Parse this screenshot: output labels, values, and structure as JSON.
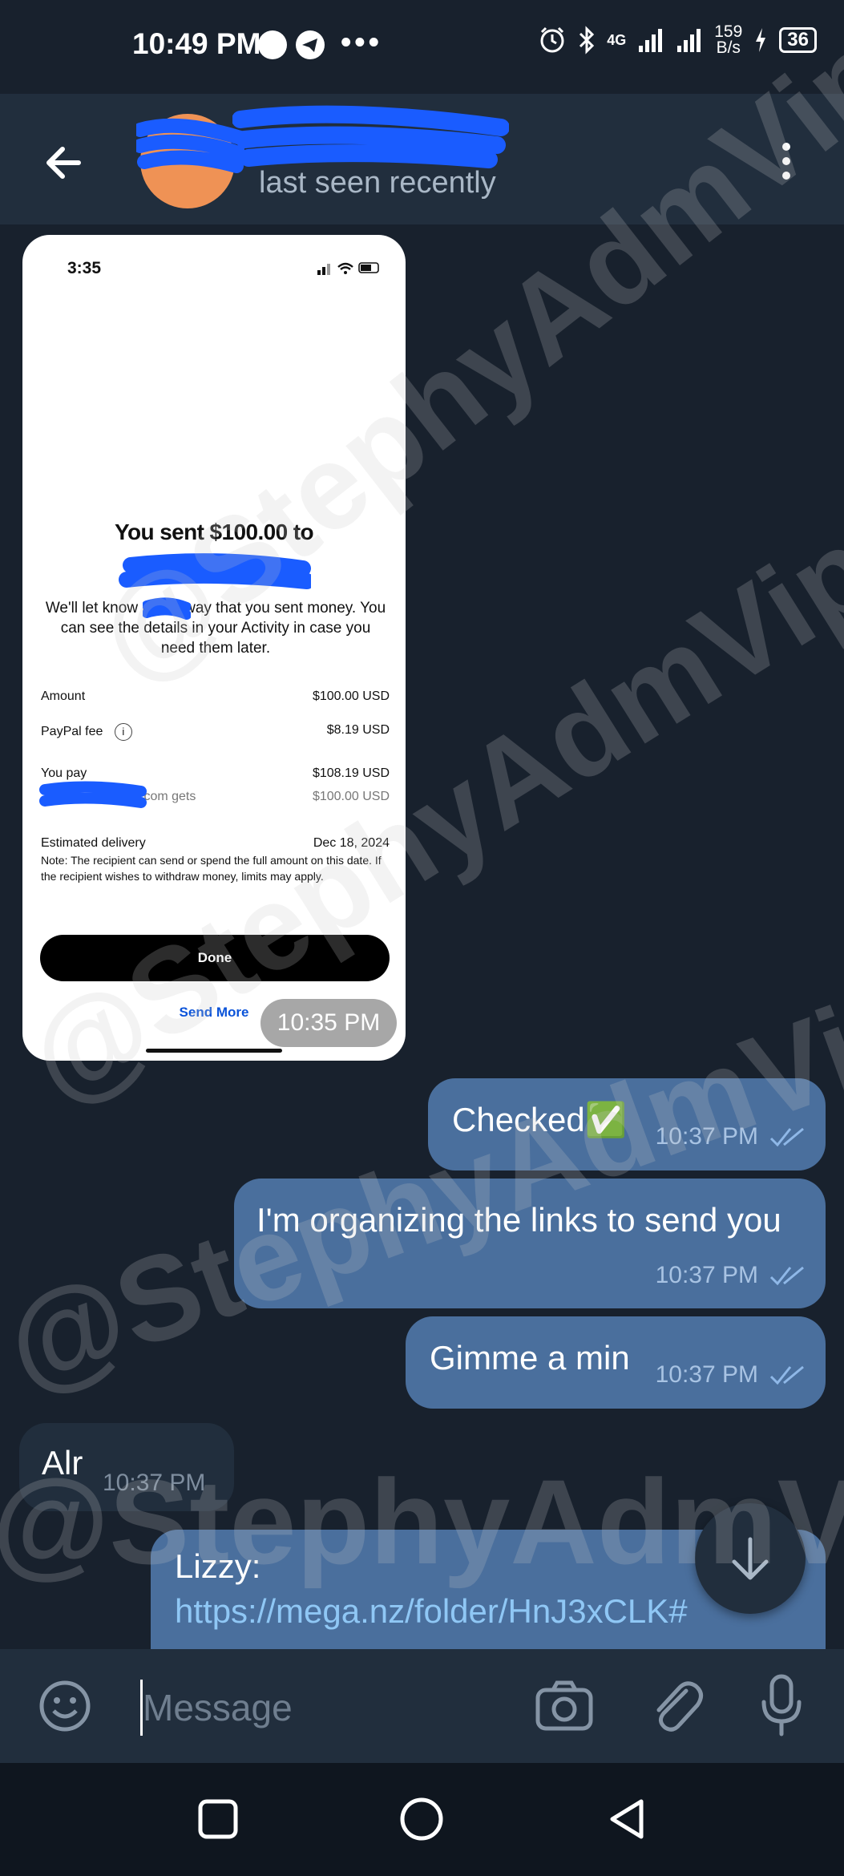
{
  "status_bar": {
    "time": "10:49 PM",
    "dots": "•••",
    "network_type": "4G",
    "net_speed_value": "159",
    "net_speed_unit": "B/s",
    "battery": "36"
  },
  "header": {
    "last_seen": "last seen recently"
  },
  "payment_screenshot": {
    "time": "3:35",
    "title": "You sent $100.00 to",
    "message": "We'll let      know right away that you sent money. You can see the details in your Activity in case you need them later.",
    "rows": [
      {
        "label": "Amount",
        "value": "$100.00 USD"
      },
      {
        "label": "PayPal fee",
        "value": "$8.19 USD"
      },
      {
        "label": "You pay",
        "value": "$108.19 USD"
      },
      {
        "label": "ail.com gets",
        "value": "$100.00 USD"
      },
      {
        "label": "Estimated delivery",
        "value": "Dec 18, 2024"
      }
    ],
    "note": "Note: The recipient can send or spend the full amount on this date. If the recipient wishes to withdraw money, limits may apply.",
    "done_label": "Done",
    "send_more_label": "Send More",
    "sent_time": "10:35 PM"
  },
  "messages": [
    {
      "text": "Checked✅",
      "time": "10:37 PM"
    },
    {
      "text": "I'm organizing the links to send you",
      "time": "10:37 PM"
    },
    {
      "text": "Gimme a min",
      "time": "10:37 PM"
    },
    {
      "text": "Alr",
      "time": "10:37 PM"
    },
    {
      "text": "Lizzy:",
      "link": "https://mega.nz/folder/HnJ3xCLK#"
    }
  ],
  "input": {
    "placeholder": "Message"
  },
  "watermark": "@StephyAdmVip",
  "colors": {
    "background": "#18212d",
    "header": "#212e3d",
    "outgoing_bubble": "#4a6f9d",
    "link": "#8fc7f5",
    "redaction": "#1a5cff"
  }
}
